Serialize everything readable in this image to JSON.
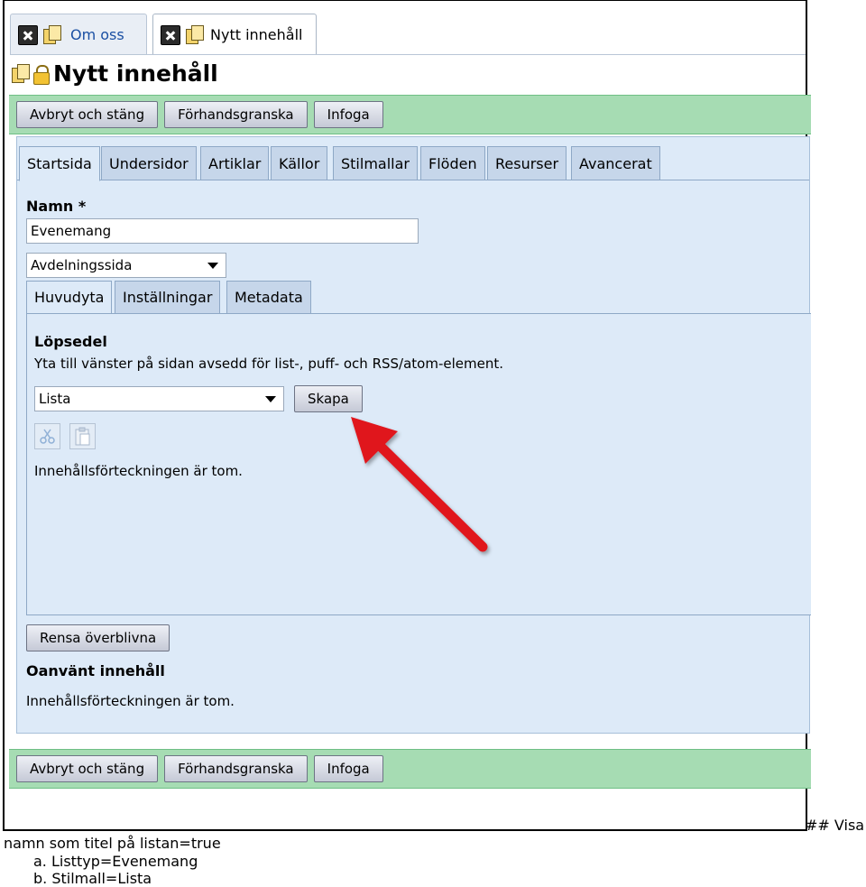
{
  "doc_tabs": [
    {
      "label": "Om oss",
      "active": false
    },
    {
      "label": "Nytt innehåll",
      "active": true
    }
  ],
  "page_title": "Nytt innehåll",
  "toolbar": {
    "cancel_label": "Avbryt och stäng",
    "preview_label": "Förhandsgranska",
    "insert_label": "Infoga"
  },
  "main_tabs": [
    "Startsida",
    "Undersidor",
    "Artiklar",
    "Källor",
    "Stilmallar",
    "Flöden",
    "Resurser",
    "Avancerat"
  ],
  "name_field": {
    "label": "Namn *",
    "value": "Evenemang"
  },
  "page_type": {
    "selected": "Avdelningssida"
  },
  "sub_tabs": [
    "Huvudyta",
    "Inställningar",
    "Metadata"
  ],
  "section": {
    "title": "Löpsedel",
    "description": "Yta till vänster på sidan avsedd för list-, puff- och RSS/atom-element.",
    "list_select": "Lista",
    "create_label": "Skapa",
    "empty_text": "Innehållsförteckningen är tom."
  },
  "clear_label": "Rensa överblivna",
  "unused": {
    "title": "Oanvänt innehåll",
    "empty_text": "Innehållsförteckningen är tom."
  },
  "caption": {
    "heading_mark": "## Visa",
    "line1": "namn som titel på listan=true",
    "item_a": "a.  Listtyp=Evenemang",
    "item_b": "b.  Stilmall=Lista"
  },
  "colors": {
    "toolbar_green": "#a6dcb3",
    "panel_blue": "#ddeaf8",
    "tab_blue": "#c6d6ea",
    "arrow_red": "#e0171f"
  }
}
